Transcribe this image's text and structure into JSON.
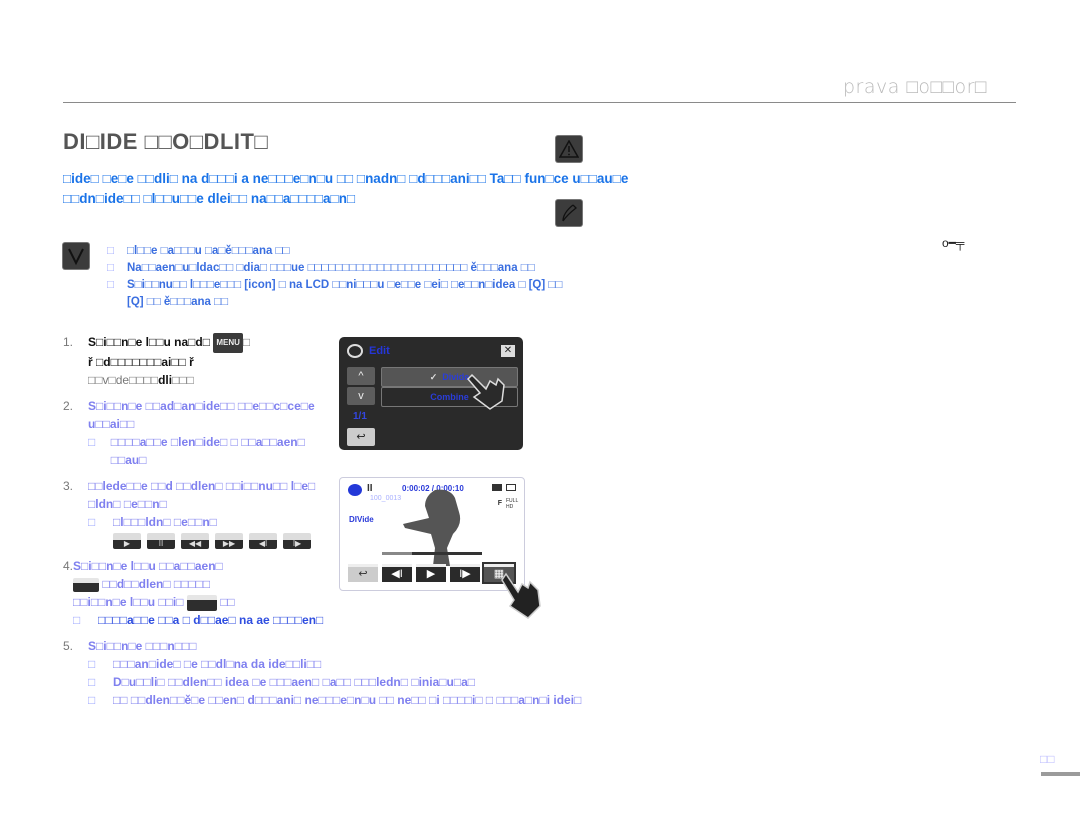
{
  "header": {
    "section_title": "prava □o□□or□"
  },
  "title": "DI□IDE □□O□DLIT□",
  "intro": "□ide□ □e□e □□dli□ na d□□□i a ne□□□e□n□u □□ □nadn□ □d□□□ani□□ Ta□□ fun□ce u□□au□e □□dn□ide□□ □l□□u□□e dlei□□ na□□a□□□□a□n□",
  "prerequisites": [
    "□l□□e □a□□□u □a□ě□□□ana □□",
    "Na□□aen□u□ldac□□ □dia□ □□□ue □□□□□□□□□□□□□□□□□□□□□□□ ě□□□ana □□",
    "S□i□□nu□□ l□□□e□□□ [icon] □ na LCD □□ni□□□u □e□□e □ei□ □e□□n□idea □ [Q] □□ [Q] □□ ě□□□ana □□"
  ],
  "steps": [
    {
      "num": "1.",
      "line1": "S□i□□n□e l□□u na□d□",
      "line1_tail": "□",
      "line2": "ř □d□□□□□□□ai□□ ř",
      "line3_pre": "□□v□de□□□□",
      "line3_bold": "dli",
      "line3_post": "□□□"
    },
    {
      "num": "2.",
      "text": "S□i□□n□e □□ad□an□ide□□ □□e□□c□ce□e u□□ai□□",
      "sub": [
        "□□□□a□□e □len□ide□ □ □□a□□aen□ □□au□"
      ]
    },
    {
      "num": "3.",
      "text": "□□lede□□e □□d □□dlen□ □□i□□nu□□ l□e□ □ldn□ □e□□n□",
      "sub": [
        "□l□□□ldn□ □e□□n□"
      ],
      "controls": [
        "play",
        "pause",
        "rewind",
        "fast-forward",
        "step-back",
        "step-forward"
      ]
    },
    {
      "num": "4.",
      "text_a": "S□i□□n□e l□□u □□a□□aen□",
      "text_b": "□□d□□dlen□ □□□□□",
      "text_c": "□□i□□n□e l□□u □□i□",
      "text_c_tail": "□□",
      "sub": [
        "□□□□a□□e □□a □ d□□ae□ na ae □□□□en□"
      ]
    },
    {
      "num": "5.",
      "text": "S□i□□n□e □□□n□□□",
      "sub": [
        "□□□an□ide□ □e □□dl□na da ide□□li□□",
        "D□u□□li□ □□dlen□□ idea □e □□□aen□ □a□□ □□□ledn□ □inia□u□a□",
        "□□ □□dlen□□ě□e □□en□ d□□□ani□ ne□□□e□n□u □□ ne□□ □i □□□□i□ □ □□□a□n□i idei□"
      ]
    }
  ],
  "screen_edit": {
    "title": "Edit",
    "up": "^",
    "down": "v",
    "page": "1/1",
    "back": "↩",
    "items": [
      {
        "label": "Divide",
        "checked": true
      },
      {
        "label": "Combine",
        "checked": false
      }
    ]
  },
  "screen_play": {
    "status": "II",
    "timecode": "0:00:02 / 0:00:10",
    "file": "100_0013",
    "mode": "DIVide",
    "quality": "F",
    "resolution": "FULL HD",
    "progress": 0.3
  },
  "page_number": "□□"
}
